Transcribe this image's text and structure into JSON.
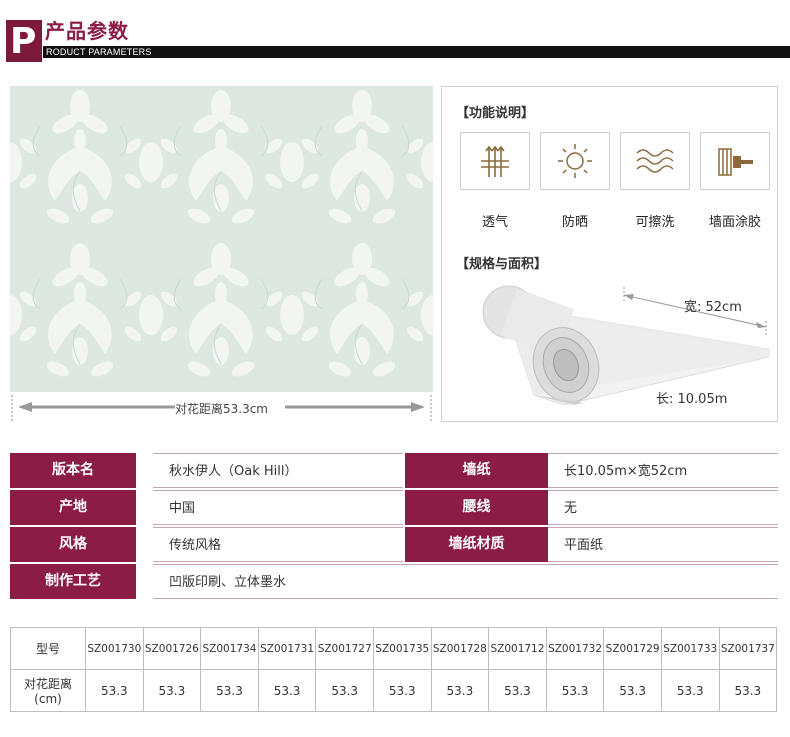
{
  "header": {
    "title": "产品参数",
    "subtitle": "RODUCT PARAMETERS",
    "logo_letter": "P"
  },
  "swatch": {
    "repeat_label": "对花距离53.3cm"
  },
  "features": {
    "title": "【功能说明】",
    "items": [
      {
        "label": "透气",
        "icon": "breathable-icon"
      },
      {
        "label": "防晒",
        "icon": "sun-icon"
      },
      {
        "label": "可擦洗",
        "icon": "wave-icon"
      },
      {
        "label": "墙面涂胶",
        "icon": "glue-brush-icon"
      }
    ]
  },
  "spec": {
    "title": "【规格与面积】",
    "width_label": "宽: 52cm",
    "length_label": "长: 10.05m"
  },
  "params": {
    "rows": [
      {
        "label1": "版本名",
        "value1": "秋水伊人（Oak Hill）",
        "label2": "墙纸",
        "value2": "长10.05m×宽52cm"
      },
      {
        "label1": "产地",
        "value1": "中国",
        "label2": "腰线",
        "value2": "无"
      },
      {
        "label1": "风格",
        "value1": "传统风格",
        "label2": "墙纸材质",
        "value2": "平面纸"
      },
      {
        "label1": "制作工艺",
        "value1": "凹版印刷、立体墨水"
      }
    ]
  },
  "models": {
    "header_label": "型号",
    "repeat_label_line1": "对花距离",
    "repeat_label_line2": "(cm)",
    "codes": [
      "SZ001730",
      "SZ001726",
      "SZ001734",
      "SZ001731",
      "SZ001727",
      "SZ001735",
      "SZ001728",
      "SZ001712",
      "SZ001732",
      "SZ001729",
      "SZ001733",
      "SZ001737"
    ],
    "repeats": [
      "53.3",
      "53.3",
      "53.3",
      "53.3",
      "53.3",
      "53.3",
      "53.3",
      "53.3",
      "53.3",
      "53.3",
      "53.3",
      "53.3"
    ]
  },
  "colors": {
    "brand": "#8b1c46",
    "swatch_bg": "#dfe9e3"
  }
}
